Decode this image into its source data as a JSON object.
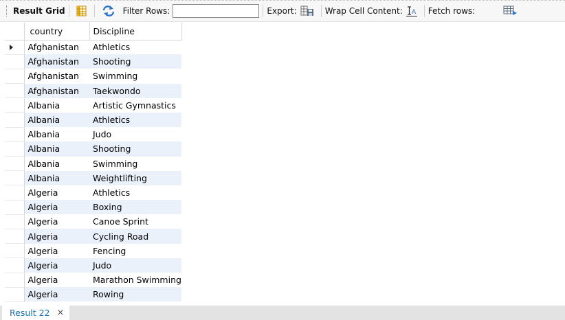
{
  "toolbar": {
    "result_grid_label": "Result Grid",
    "filter_rows_label": "Filter Rows:",
    "filter_value": "",
    "export_label": "Export:",
    "wrap_label": "Wrap Cell Content:",
    "fetch_label": "Fetch rows:"
  },
  "grid": {
    "columns": [
      "country",
      "Discipline"
    ],
    "rows": [
      [
        "Afghanistan",
        "Athletics"
      ],
      [
        "Afghanistan",
        "Shooting"
      ],
      [
        "Afghanistan",
        "Swimming"
      ],
      [
        "Afghanistan",
        "Taekwondo"
      ],
      [
        "Albania",
        "Artistic Gymnastics"
      ],
      [
        "Albania",
        "Athletics"
      ],
      [
        "Albania",
        "Judo"
      ],
      [
        "Albania",
        "Shooting"
      ],
      [
        "Albania",
        "Swimming"
      ],
      [
        "Albania",
        "Weightlifting"
      ],
      [
        "Algeria",
        "Athletics"
      ],
      [
        "Algeria",
        "Boxing"
      ],
      [
        "Algeria",
        "Canoe Sprint"
      ],
      [
        "Algeria",
        "Cycling Road"
      ],
      [
        "Algeria",
        "Fencing"
      ],
      [
        "Algeria",
        "Judo"
      ],
      [
        "Algeria",
        "Marathon Swimming"
      ],
      [
        "Algeria",
        "Rowing"
      ]
    ]
  },
  "tabs": [
    {
      "label": "Result 22",
      "close": "×"
    }
  ],
  "icons": {
    "grid_view": "grid-view-icon",
    "refresh": "refresh-icon",
    "export": "export-icon",
    "wrap": "wrap-cell-icon",
    "fetch": "fetch-rows-icon"
  }
}
